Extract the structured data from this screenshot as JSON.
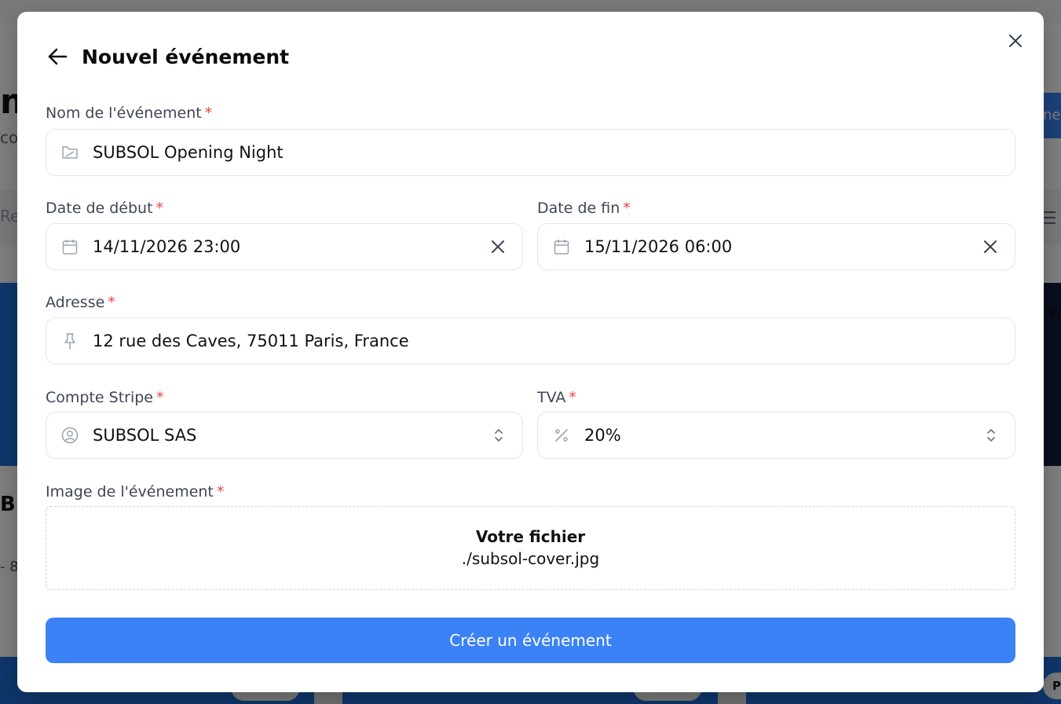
{
  "modal": {
    "title": "Nouvel événement",
    "back_icon": "arrow-left-icon",
    "close_icon": "close-icon"
  },
  "form": {
    "required_mark": "*",
    "event_name": {
      "label": "Nom de l'événement",
      "value": "SUBSOL Opening Night",
      "icon": "folder-icon"
    },
    "start_date": {
      "label": "Date de début",
      "value": "14/11/2026 23:00",
      "icon": "calendar-icon"
    },
    "end_date": {
      "label": "Date de fin",
      "value": "15/11/2026 06:00",
      "icon": "calendar-icon"
    },
    "address": {
      "label": "Adresse",
      "value": "12 rue des Caves, 75011 Paris, France",
      "icon": "pin-icon"
    },
    "stripe_account": {
      "label": "Compte Stripe",
      "value": "SUBSOL SAS",
      "icon": "user-circle-icon"
    },
    "vat": {
      "label": "TVA",
      "value": "20%",
      "icon": "percent-icon"
    },
    "image": {
      "label": "Image de l'événement",
      "file_heading": "Votre fichier",
      "file_name": "./subsol-cover.jpg"
    },
    "submit_label": "Créer un événement"
  },
  "colors": {
    "accent": "#3b82f6",
    "required": "#ef4444"
  }
}
